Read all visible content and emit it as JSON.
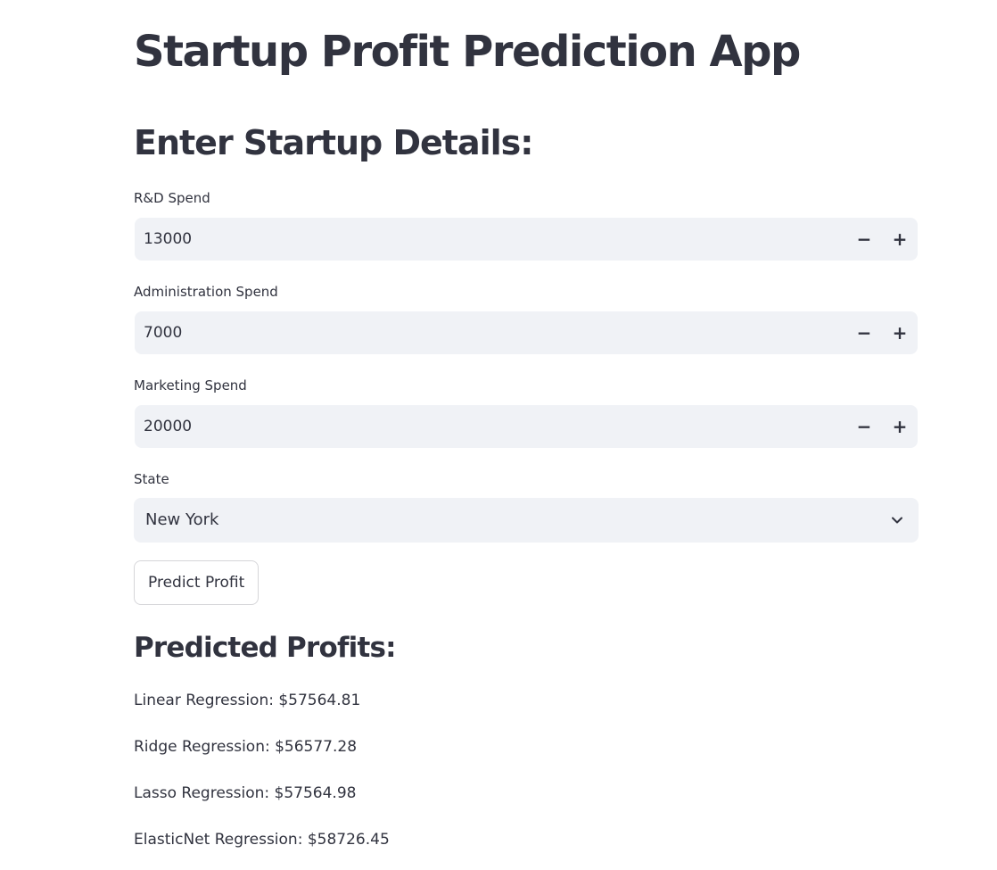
{
  "app": {
    "title": "Startup Profit Prediction App"
  },
  "form": {
    "section_title": "Enter Startup Details:",
    "fields": [
      {
        "label": "R&D Spend",
        "value": "13000"
      },
      {
        "label": "Administration Spend",
        "value": "7000"
      },
      {
        "label": "Marketing Spend",
        "value": "20000"
      }
    ],
    "stepper": {
      "minus": "−",
      "plus": "+"
    },
    "state": {
      "label": "State",
      "selected": "New York"
    },
    "submit_label": "Predict Profit"
  },
  "icons": {
    "decrement": "minus-icon",
    "increment": "plus-icon",
    "dropdown": "chevron-down-icon"
  },
  "results": {
    "title": "Predicted Profits:",
    "lines": [
      "Linear Regression: $57564.81",
      "Ridge Regression: $56577.28",
      "Lasso Regression: $57564.98",
      "ElasticNet Regression: $58726.45"
    ]
  }
}
